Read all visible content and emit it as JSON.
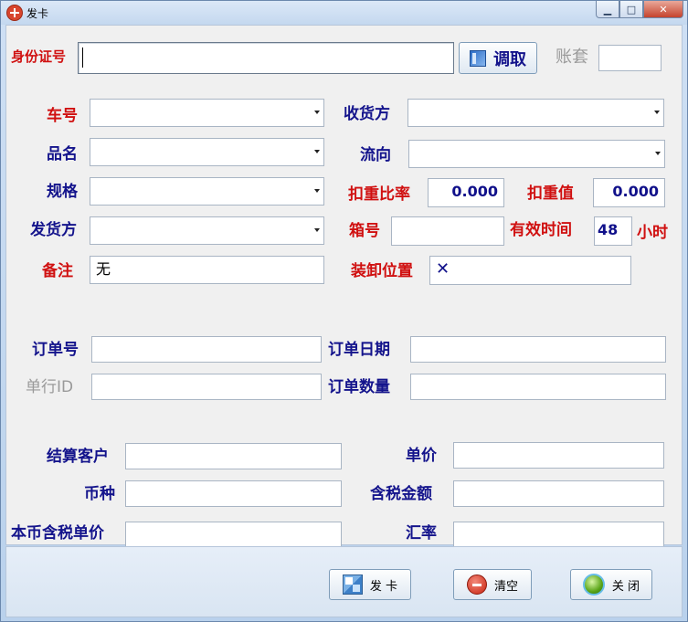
{
  "window": {
    "title": "发卡"
  },
  "form": {
    "id_card": {
      "label": "身份证号",
      "value": ""
    },
    "fetch_button": "调取",
    "account_set": {
      "label": "账套",
      "value": ""
    },
    "vehicle_no": {
      "label": "车号",
      "value": ""
    },
    "consignee": {
      "label": "收货方",
      "value": ""
    },
    "product_name": {
      "label": "品名",
      "value": ""
    },
    "flow_direction": {
      "label": "流向",
      "value": ""
    },
    "specification": {
      "label": "规格",
      "value": ""
    },
    "deduction_ratio": {
      "label": "扣重比率",
      "value": "0.000"
    },
    "deduction_value": {
      "label": "扣重值",
      "value": "0.000"
    },
    "shipper": {
      "label": "发货方",
      "value": ""
    },
    "box_no": {
      "label": "箱号",
      "value": ""
    },
    "valid_time": {
      "label": "有效时间",
      "value": "48",
      "unit": "小时"
    },
    "remark": {
      "label": "备注",
      "value": "无"
    },
    "unload_location": {
      "label": "装卸位置",
      "value": "✕"
    },
    "order_no": {
      "label": "订单号",
      "value": ""
    },
    "order_date": {
      "label": "订单日期",
      "value": ""
    },
    "line_id": {
      "label": "单行ID",
      "value": ""
    },
    "order_qty": {
      "label": "订单数量",
      "value": ""
    },
    "settlement_customer": {
      "label": "结算客户",
      "value": ""
    },
    "unit_price": {
      "label": "单价",
      "value": ""
    },
    "currency": {
      "label": "币种",
      "value": ""
    },
    "tax_amount": {
      "label": "含税金额",
      "value": ""
    },
    "local_tax_price": {
      "label": "本币含税单价",
      "value": ""
    },
    "exchange_rate": {
      "label": "汇率",
      "value": ""
    }
  },
  "footer": {
    "issue_card": "发 卡",
    "clear": "清空",
    "close": "关 闭"
  },
  "colors": {
    "label_blue": "#14148c",
    "label_red": "#d01010",
    "panel_bg": "#f0f0f0"
  }
}
